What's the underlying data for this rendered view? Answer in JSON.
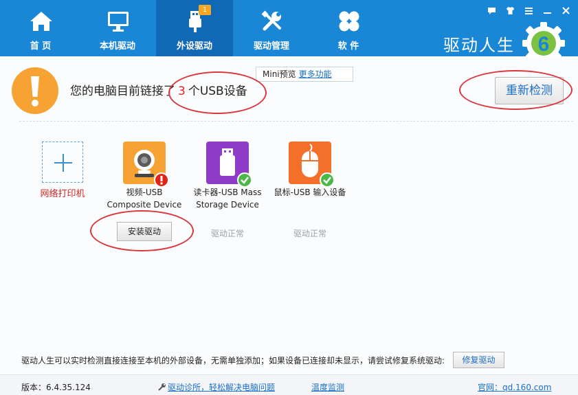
{
  "nav": {
    "items": [
      {
        "label": "首 页",
        "icon": "home-icon"
      },
      {
        "label": "本机驱动",
        "icon": "monitor-icon"
      },
      {
        "label": "外设驱动",
        "icon": "usb-icon",
        "badge": "1",
        "active": true
      },
      {
        "label": "驱动管理",
        "icon": "tools-icon"
      },
      {
        "label": "软 件",
        "icon": "apps-icon"
      }
    ]
  },
  "window_controls": [
    "chat-icon",
    "shirt-icon",
    "menu-icon",
    "minimize-icon",
    "close-icon"
  ],
  "brand": {
    "name": "驱动人生",
    "logo_digit": "6"
  },
  "status": {
    "prefix": "您的电脑目前链接了",
    "count": "3",
    "suffix": "个USB设备"
  },
  "mini_tip": {
    "label": "Mini预览",
    "link": "更多功能"
  },
  "rescan_label": "重新检测",
  "devices": {
    "add": {
      "label": "网络打印机"
    },
    "items": [
      {
        "name_line1": "视频-USB",
        "name_line2": "Composite Device",
        "state": "warning",
        "action": "安装驱动"
      },
      {
        "name_line1": "读卡器-USB Mass",
        "name_line2": "Storage Device",
        "state": "ok",
        "status": "驱动正常"
      },
      {
        "name_line1": "鼠标-USB 输入设备",
        "name_line2": "",
        "state": "ok",
        "status": "驱动正常"
      }
    ]
  },
  "hint": "驱动人生可以实时检测直接连接至本机的外部设备，无需单独添加；如果设备已连接却未显示，请尝试修复系统驱动:",
  "repair_label": "修复驱动",
  "footer": {
    "version": "版本：6.4.35.124",
    "diagnose": "驱动诊所，轻松解决电脑问题",
    "temperature": "温度监测",
    "site": "官网：qd.160.com"
  },
  "colors": {
    "accent": "#1a86d6",
    "accent_dark": "#1168b4",
    "highlight": "#e2231a",
    "link": "#1b6fc9",
    "warning_orange": "#f7a334",
    "annotation_red": "#d9363e"
  }
}
